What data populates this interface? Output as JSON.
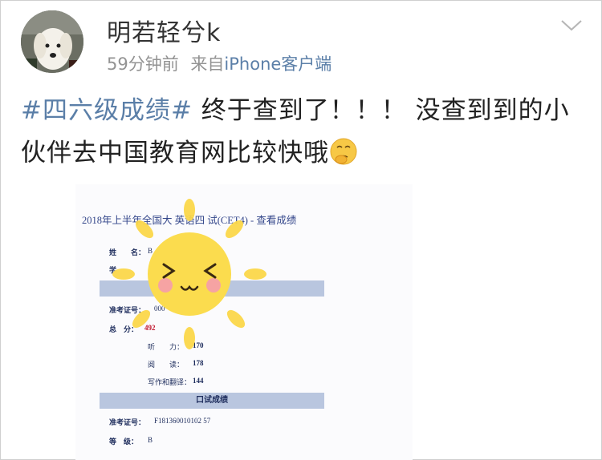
{
  "header": {
    "username": "明若轻兮k",
    "time": "59分钟前",
    "source_prefix": "来自",
    "source_client": "iPhone客户端",
    "more_icon": "chevron-down-icon"
  },
  "post": {
    "topic": "#四六级成绩#",
    "text": " 终于查到了！！！ 没查到到的小伙伴去中国教育网比较快哦",
    "emoji": "thinking-face-emoji"
  },
  "photo": {
    "doc_title": "2018年上半年全国大 英语四 试(CET4) - 查看成绩",
    "name_label": "姓　　名：",
    "name_value": "B",
    "school_label": "学",
    "ticket_label": "准考证号：",
    "ticket_value": "000",
    "total_label": "总　分：",
    "total_value": "492",
    "listening_label": "听　　力：",
    "listening_value": "170",
    "reading_label": "阅　　读：",
    "reading_value": "178",
    "writing_label": "写作和翻译：",
    "writing_value": "144",
    "oral_header": "口试成绩",
    "oral_ticket_label": "准考证号：",
    "oral_ticket_value": "F181360010102 57",
    "grade_label": "等　级：",
    "grade_value": "B",
    "sticker": "sun-sticker"
  }
}
